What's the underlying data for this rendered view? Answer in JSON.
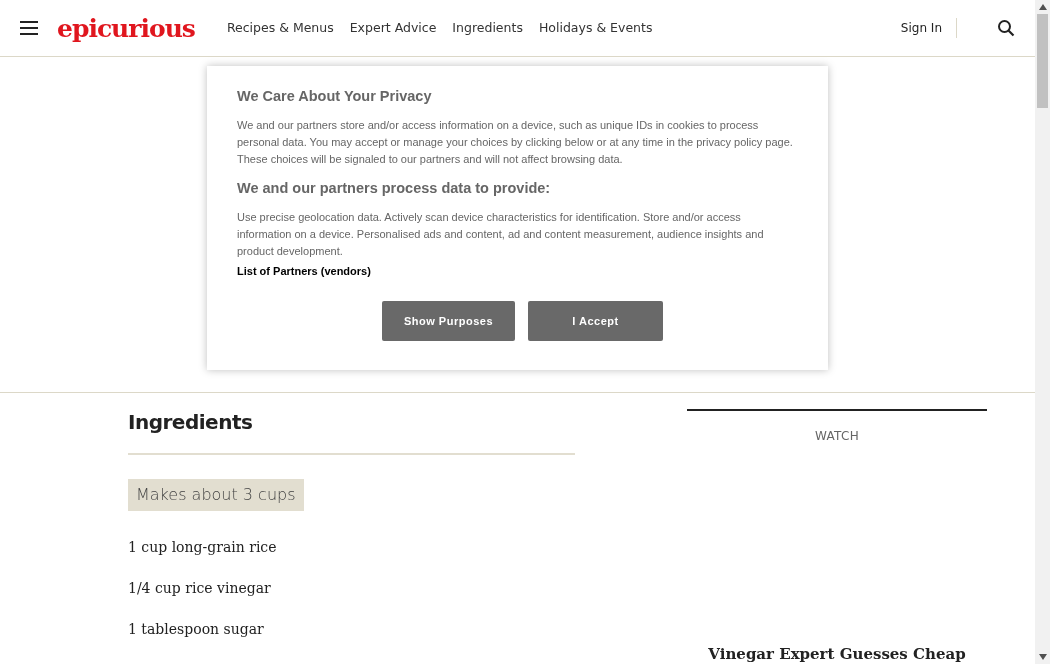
{
  "header": {
    "logo": "epicurious",
    "nav": [
      "Recipes & Menus",
      "Expert Advice",
      "Ingredients",
      "Holidays & Events"
    ],
    "sign_in": "Sign In"
  },
  "consent": {
    "title": "We Care About Your Privacy",
    "intro": "We and our partners store and/or access information on a device, such as unique IDs in cookies to process personal data. You may accept or manage your choices by clicking below or at any time in the privacy policy page. These choices will be signaled to our partners and will not affect browsing data.",
    "subtitle": "We and our partners process data to provide:",
    "purposes": "Use precise geolocation data. Actively scan device characteristics for identification. Store and/or access information on a device. Personalised ads and content, ad and content measurement, audience insights and product development.",
    "partners_link": "List of Partners (vendors)",
    "buttons": [
      "Show Purposes",
      "I Accept"
    ]
  },
  "ingredients": {
    "title": "Ingredients",
    "yield": "Makes about 3 cups",
    "items": [
      "1 cup long-grain rice",
      "1/4 cup rice vinegar",
      "1 tablespoon sugar"
    ]
  },
  "watch": {
    "label": "WATCH",
    "video_title": "Vinegar Expert Guesses Cheap"
  }
}
